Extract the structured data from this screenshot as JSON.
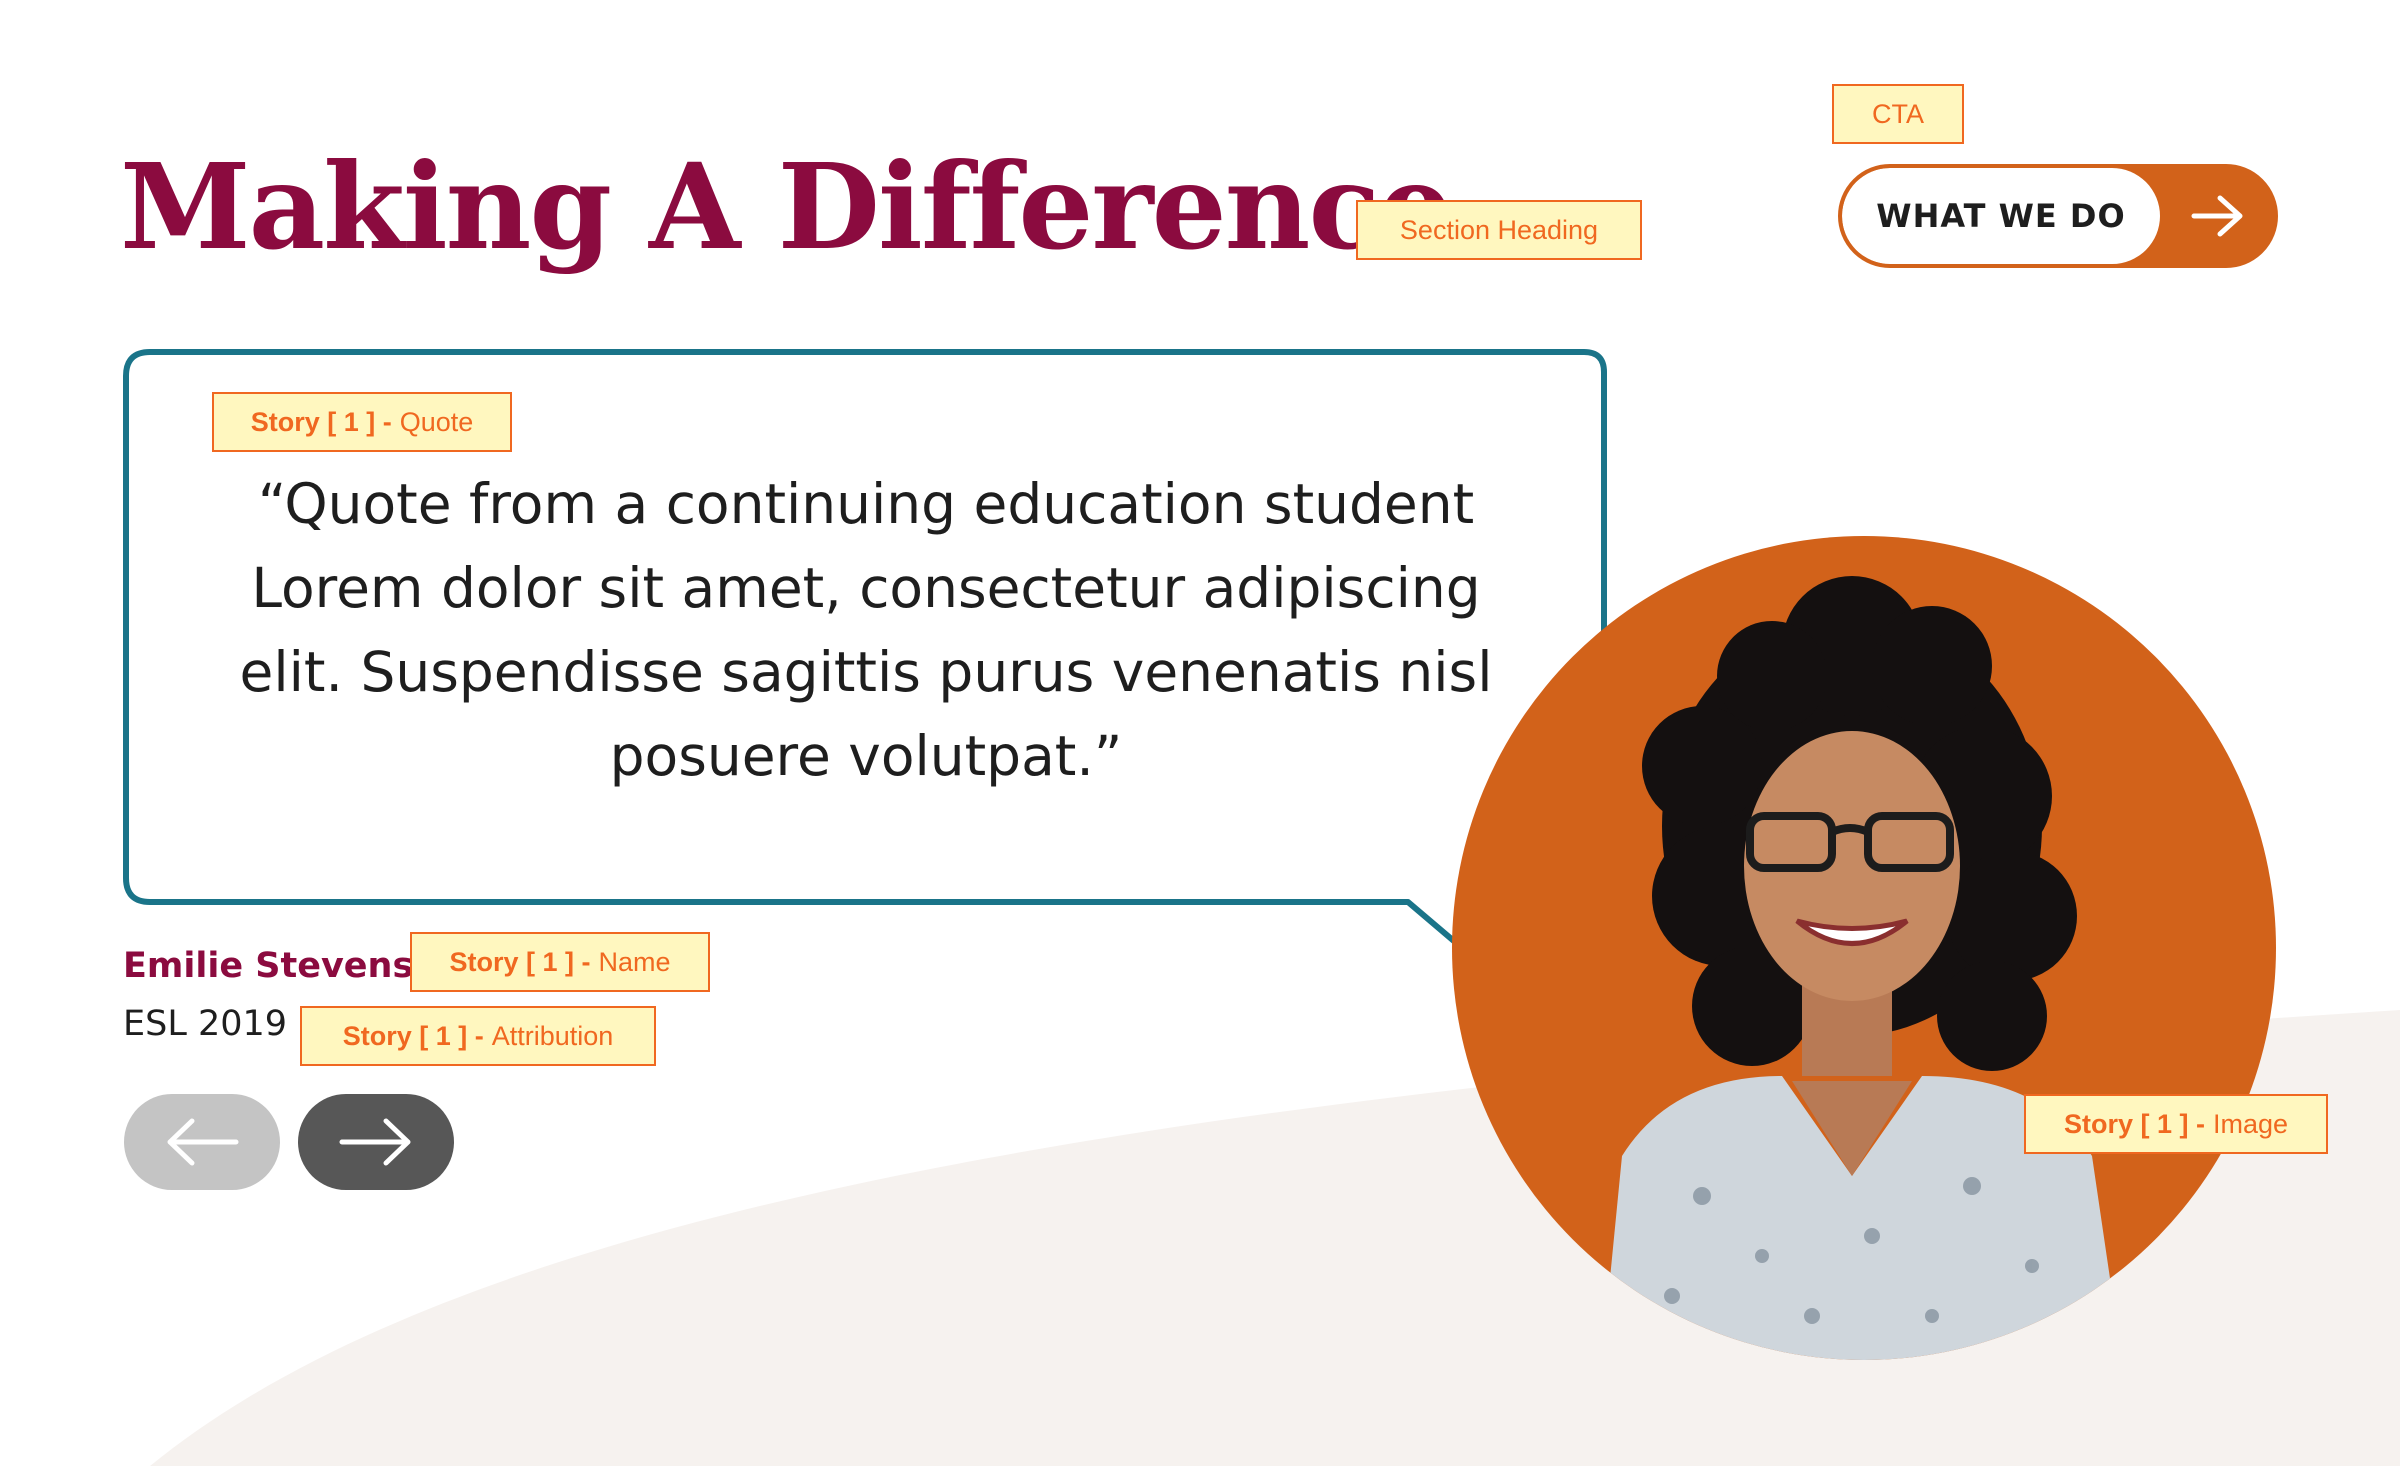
{
  "section": {
    "heading": "Making A Difference",
    "cta_label": "WHAT WE DO",
    "cta_icon": "arrow-right-icon"
  },
  "story": {
    "quote": "“Quote from a continuing education student Lorem dolor sit amet, consectetur adipiscing elit. Suspendisse sagittis purus venenatis nisl posuere volutpat.”",
    "name": "Emilie Stevens",
    "attribution": "ESL 2019",
    "image_icon": "student-portrait"
  },
  "nav": {
    "prev_icon": "arrow-left-icon",
    "next_icon": "arrow-right-icon"
  },
  "annotations": {
    "cta": "CTA",
    "section_heading": "Section Heading",
    "quote_prefix": "Story [ 1 ] -",
    "quote_suffix": "Quote",
    "name_prefix": "Story [ 1 ] -",
    "name_suffix": "Name",
    "attribution_prefix": "Story [ 1 ] -",
    "attribution_suffix": "Attribution",
    "image_prefix": "Story [ 1 ] -",
    "image_suffix": "Image"
  },
  "colors": {
    "heading": "#8b0b3f",
    "accent_orange": "#d2621a",
    "bubble_border": "#1a7489",
    "background_curve": "#f6f2ef",
    "annotation_bg": "#fff7bf",
    "annotation_text": "#f06820"
  }
}
